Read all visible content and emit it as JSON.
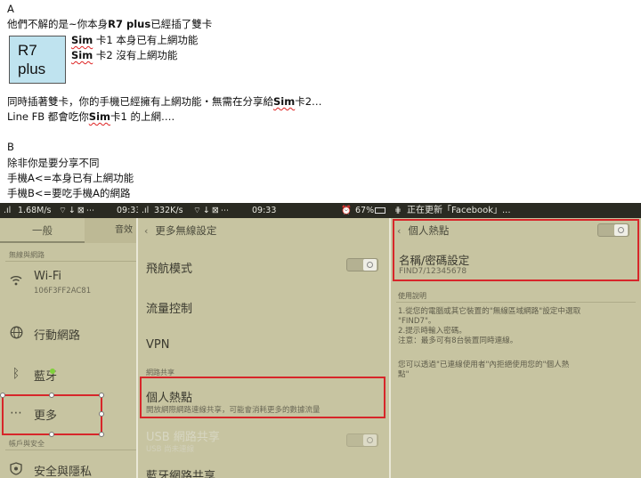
{
  "doc": {
    "A_label": "A",
    "line_A1_prefix": "他們不解的是~你本身",
    "line_A1_bold": "R7 plus",
    "line_A1_suffix": "已經插了雙卡",
    "r7_line1": "R7",
    "r7_line2": "plus",
    "sim_word": "Sim",
    "sim1_text": "卡1 本身已有上網功能",
    "sim2_text": "卡2 沒有上網功能",
    "para1_prefix": "同時插著雙卡，你的手機已經擁有上網功能・無需在分享給",
    "para1_sim": "Sim",
    "para1_suffix": "卡2…",
    "para2_prefix": "Line FB 都會吃你",
    "para2_sim": "Sim",
    "para2_suffix": "卡1 的上網….",
    "B_label": "B",
    "B_line1": "除非你是要分享不同",
    "B_line2": "手機A<=本身已有上網功能",
    "B_line3": "手機B<=要吃手機A的網路"
  },
  "status1": {
    "speed": "1.68M/s",
    "time": "09:33"
  },
  "status2": {
    "speed": "332K/s",
    "time": "09:33",
    "battery": "67%"
  },
  "status3": {
    "text": "正在更新「Facebook」..."
  },
  "panel1": {
    "tab_general": "一般",
    "tab_sound": "音效",
    "section_network": "無線與網路",
    "wifi_label": "Wi-Fi",
    "wifi_ssid": "106F3FF2AC81",
    "mobile_label": "行動網路",
    "bluetooth_label": "藍牙",
    "more_label": "更多",
    "section_account": "帳戶與安全",
    "security_label": "安全與隱私"
  },
  "panel2": {
    "title": "更多無線設定",
    "airplane": "飛航模式",
    "data_control": "流量控制",
    "vpn": "VPN",
    "section_sharing": "網路共享",
    "hotspot": "個人熱點",
    "hotspot_desc": "開放網際網路連線共享，可能會消耗更多的數據流量",
    "usb_tether": "USB 網路共享",
    "usb_desc": "USB 尚未連線",
    "bt_tether": "藍牙網路共享"
  },
  "panel3": {
    "title": "個人熱點",
    "name_pw": "名稱/密碼設定",
    "ssid_pw": "FIND7/12345678",
    "usage_title": "使用說明",
    "usage_1": "1.從您的電腦或其它裝置的\"無線區域網路\"設定中選取",
    "usage_1b": "\"FIND7\"。",
    "usage_2": "2.提示時輸入密碼。",
    "usage_note": "注意：最多可有8台裝置同時連線。",
    "usage_3": "您可以透過\"已連線使用者\"內拒絕使用您的\"個人熱",
    "usage_3b": "點\""
  },
  "colors": {
    "highlight_red": "#d7262a",
    "panel_bg": "#c7c4a1",
    "statusbar": "#2a2a22",
    "r7_box": "#bfe3ef"
  }
}
